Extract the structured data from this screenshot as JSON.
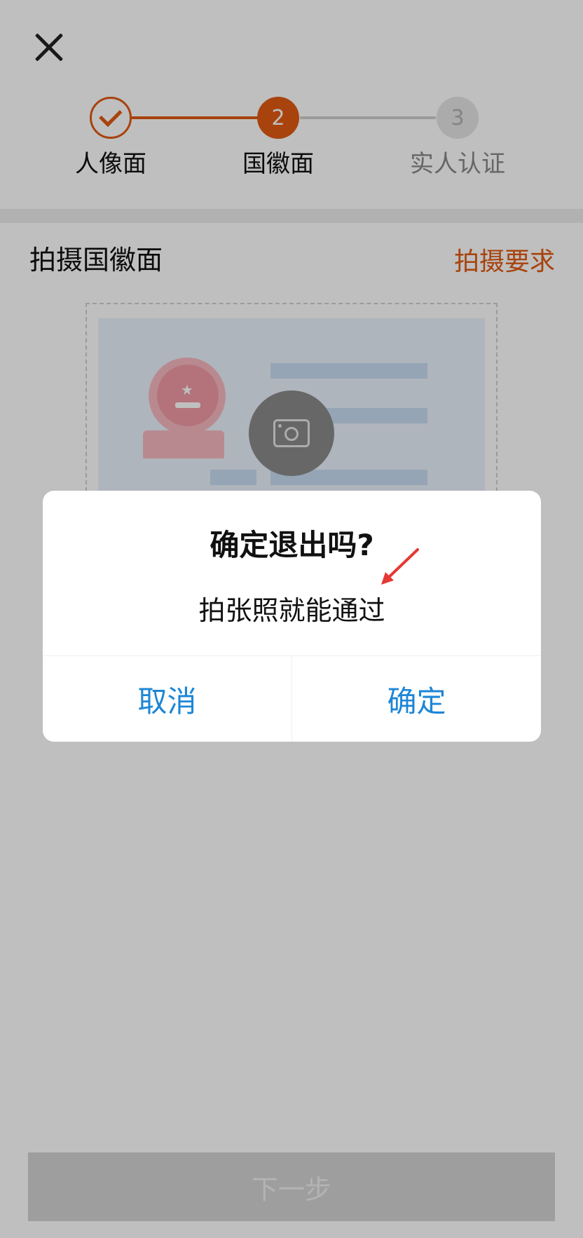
{
  "header": {
    "close_icon": "close-icon"
  },
  "stepper": {
    "steps": [
      {
        "label": "人像面",
        "state": "done"
      },
      {
        "label": "国徽面",
        "number": "2",
        "state": "active"
      },
      {
        "label": "实人认证",
        "number": "3",
        "state": "pending"
      }
    ],
    "accent_color": "#e05a12"
  },
  "section": {
    "title": "拍摄国徽面",
    "requirements_link": "拍摄要求"
  },
  "capture": {
    "camera_icon": "camera-icon"
  },
  "footer": {
    "next_label": "下一步"
  },
  "dialog": {
    "title": "确定退出吗?",
    "message": "拍张照就能通过",
    "cancel_label": "取消",
    "confirm_label": "确定",
    "button_color": "#1d86d6"
  },
  "annotation": {
    "arrow_color": "#e53935"
  }
}
